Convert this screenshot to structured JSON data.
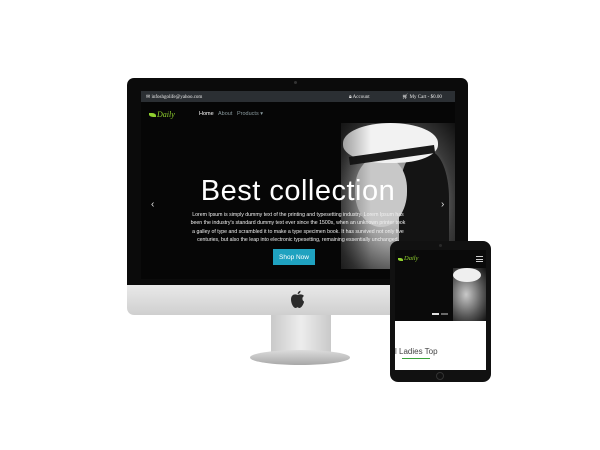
{
  "topbar": {
    "email": "infoshgolife@yahoo.com",
    "account": "Account",
    "cart": "My Cart - $0.00"
  },
  "brand": {
    "logo_text": "Daily",
    "accent_color": "#8fcf2e"
  },
  "nav": {
    "items": [
      "Home",
      "About",
      "Products"
    ]
  },
  "hero": {
    "title": "Best collection",
    "text": "Lorem Ipsum is simply dummy text of the printing and typesetting industry. Lorem Ipsum has been the industry's standard dummy text ever since the 1500s, when an unknown printer took a galley of type and scrambled it to make a type specimen book. It has survived not only five centuries, but also the leap into electronic typesetting, remaining essentially unchanged.",
    "button_label": "Shop Now",
    "button_color": "#1fa2c0",
    "prev_arrow": "‹",
    "next_arrow": "›"
  },
  "tablet": {
    "logo_text": "Daily",
    "section_title": "l Ladies Top"
  }
}
